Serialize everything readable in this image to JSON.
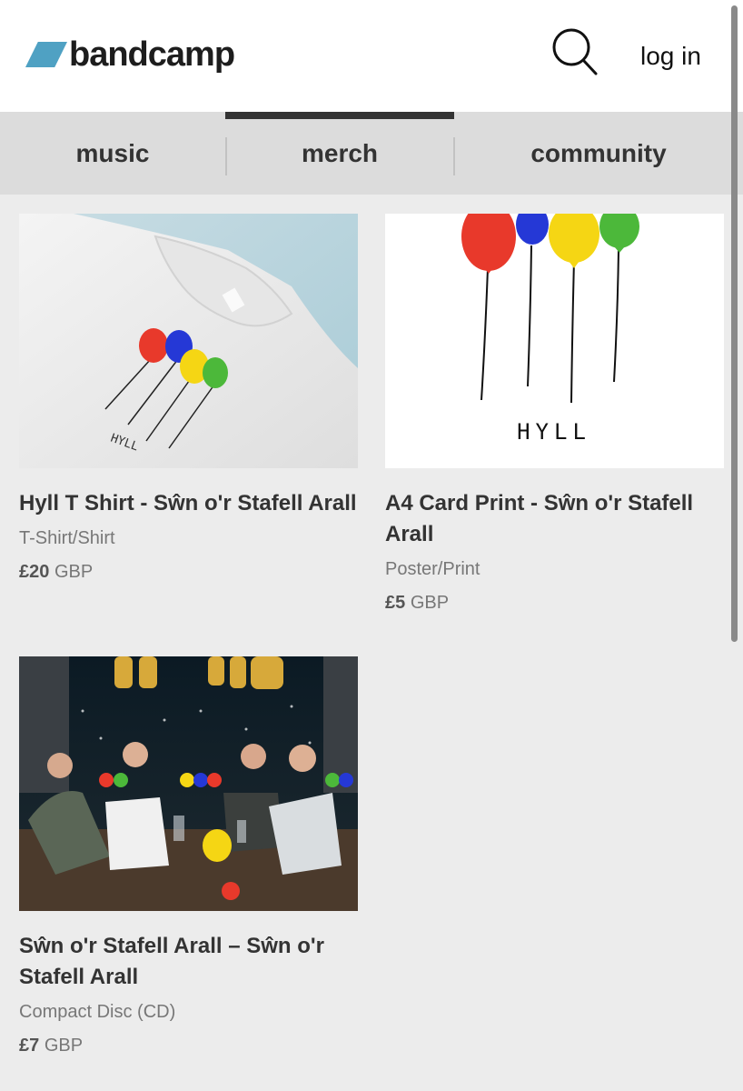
{
  "header": {
    "logo_text": "bandcamp",
    "login_label": "log in"
  },
  "nav": {
    "tabs": [
      {
        "label": "music"
      },
      {
        "label": "merch"
      },
      {
        "label": "community"
      }
    ],
    "active_tab": "merch"
  },
  "items": [
    {
      "title": "Hyll T Shirt - Sŵn o'r Stafell Arall",
      "type": "T-Shirt/Shirt",
      "price": "£20",
      "currency": "GBP",
      "image_text": "HYLL"
    },
    {
      "title": "A4 Card Print - Sŵn o'r Stafell Arall",
      "type": "Poster/Print",
      "price": "£5",
      "currency": "GBP",
      "image_text": "HYLL"
    },
    {
      "title": "Sŵn o'r Stafell Arall – Sŵn o'r Stafell Arall",
      "type": "Compact Disc (CD)",
      "price": "£7",
      "currency": "GBP"
    }
  ],
  "colors": {
    "brand": "#4fa1c3",
    "balloon_red": "#e8392b",
    "balloon_blue": "#2538d6",
    "balloon_yellow": "#f5d614",
    "balloon_green": "#4cb83a"
  }
}
